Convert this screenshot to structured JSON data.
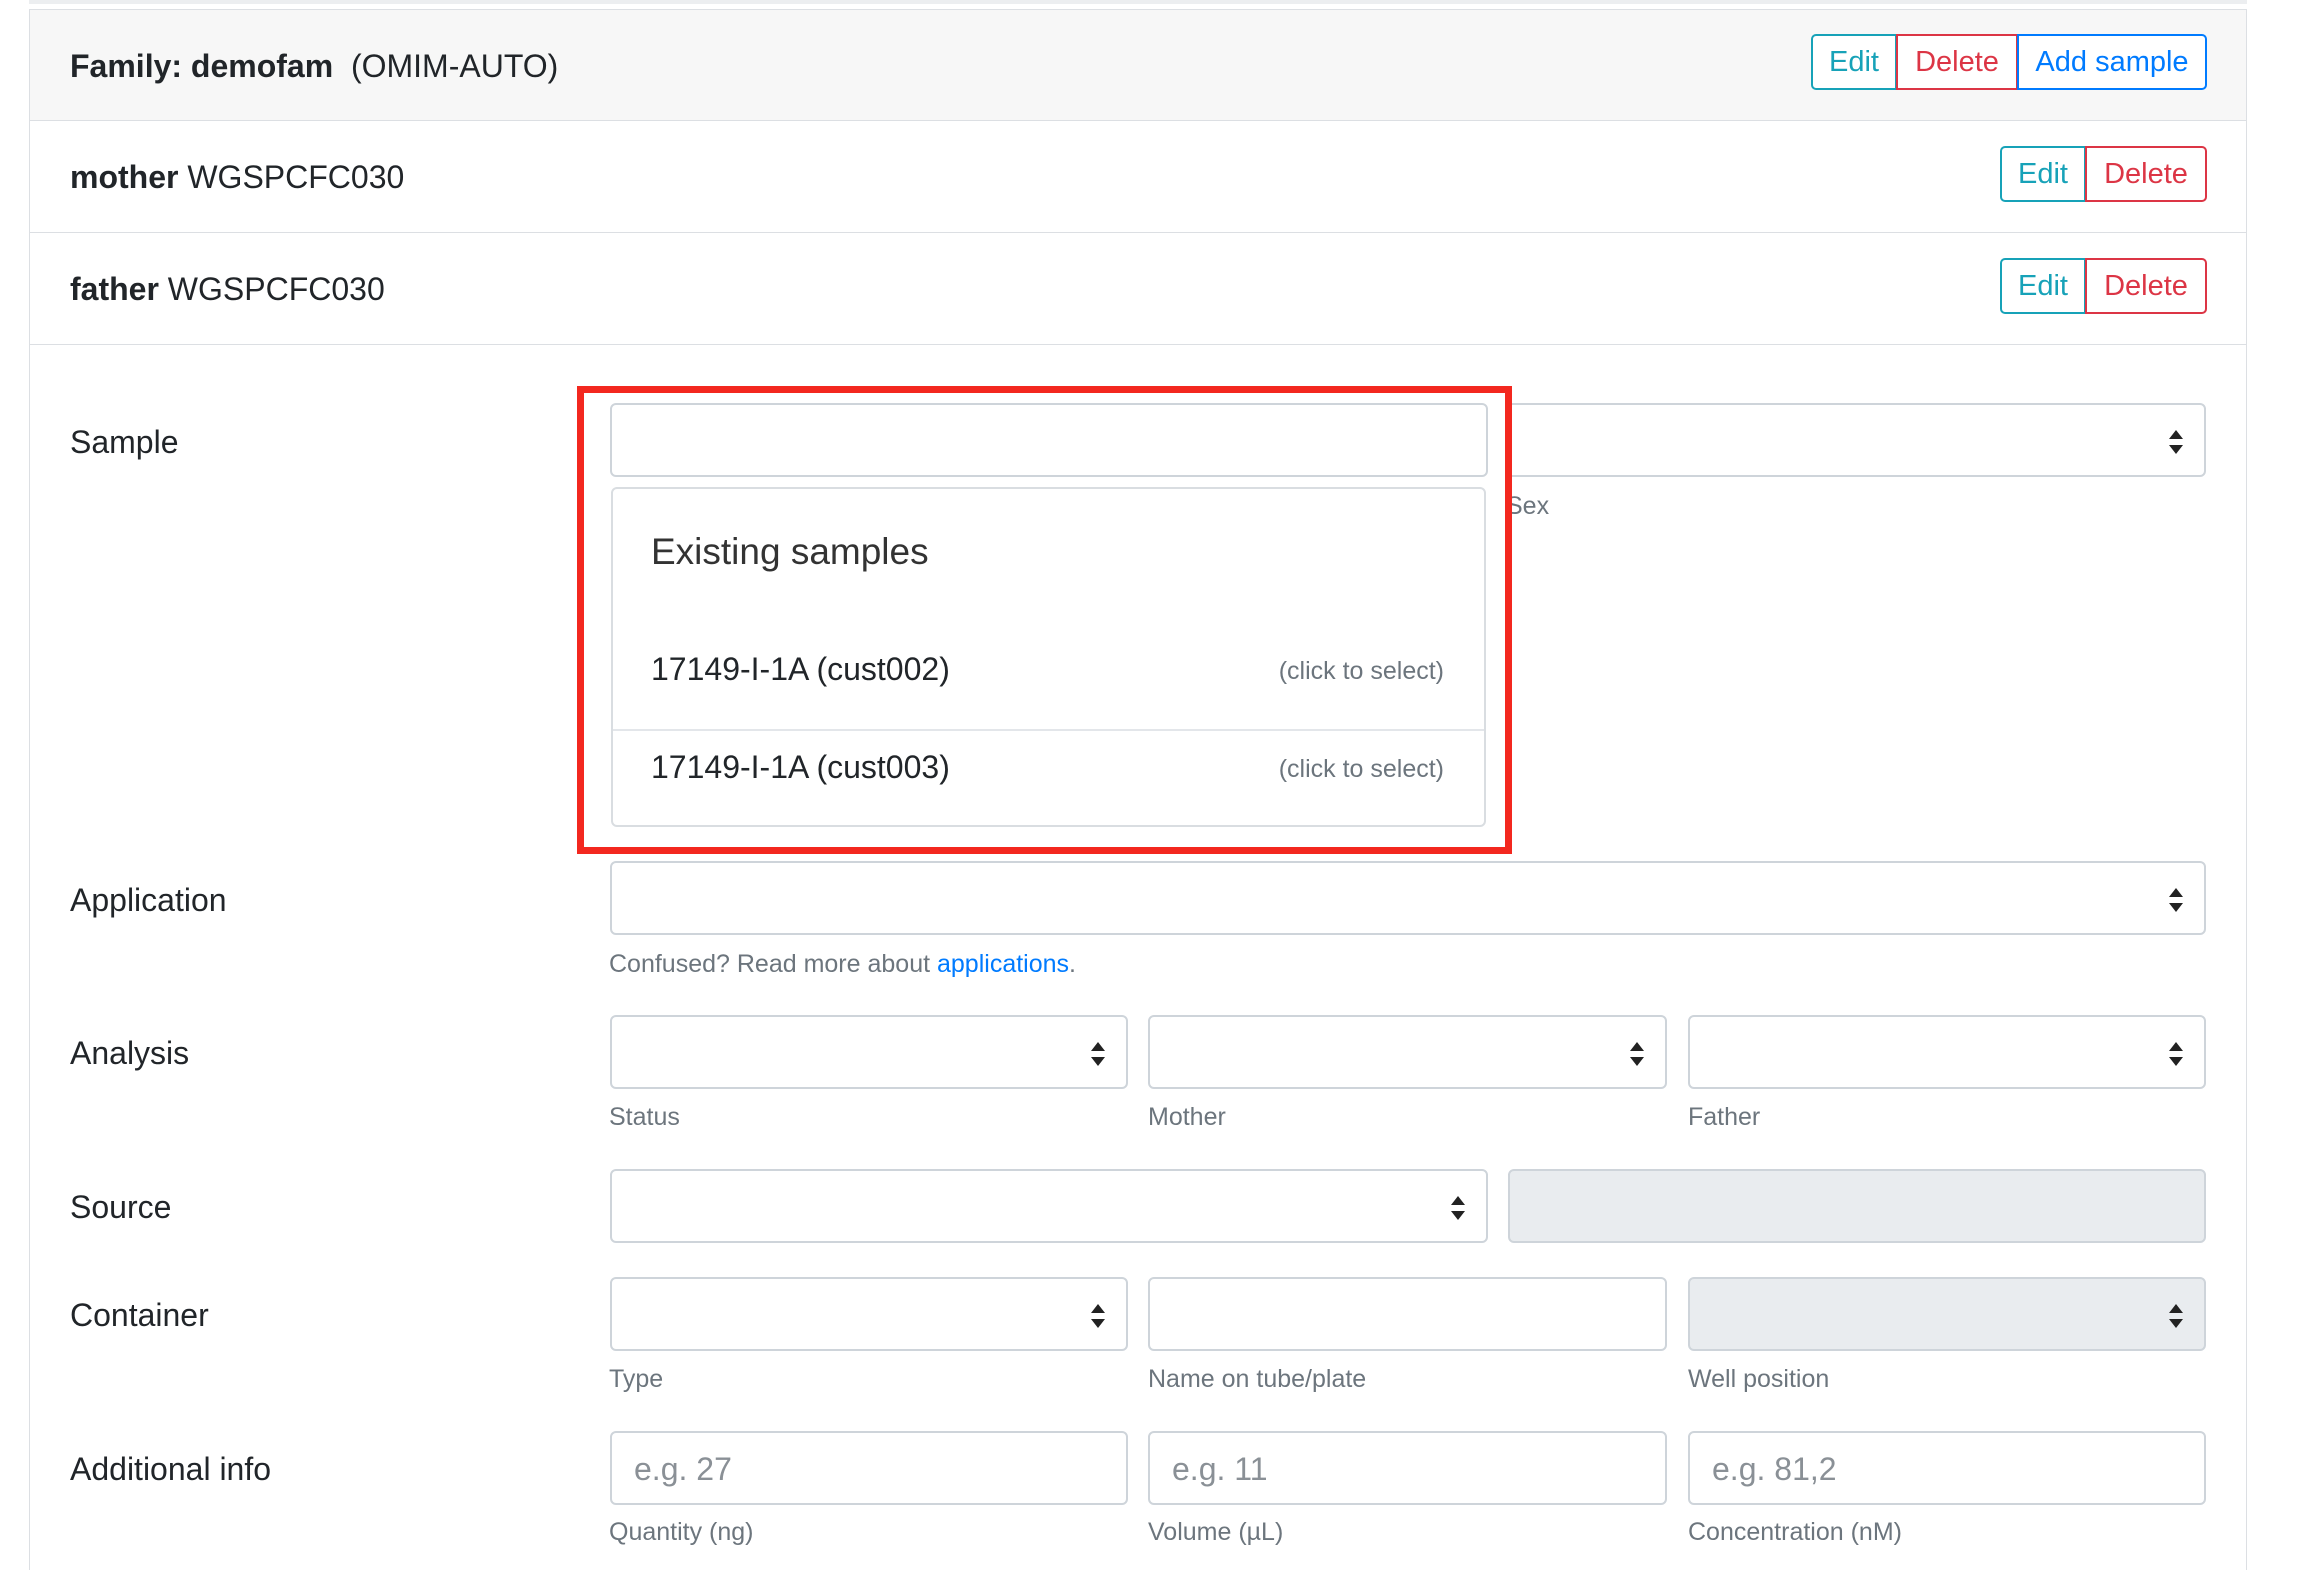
{
  "family": {
    "label": "Family: demofam",
    "panel": "(OMIM-AUTO)",
    "edit": "Edit",
    "delete": "Delete",
    "add_sample": "Add sample"
  },
  "samples": [
    {
      "relation": "mother",
      "name": "WGSPCFC030",
      "edit": "Edit",
      "delete": "Delete"
    },
    {
      "relation": "father",
      "name": "WGSPCFC030",
      "edit": "Edit",
      "delete": "Delete"
    }
  ],
  "form": {
    "sample_label": "Sample",
    "sample_input_value": "",
    "sex_help": "Sex",
    "existing": {
      "heading": "Existing samples",
      "items": [
        {
          "name": "17149-I-1A (cust002)",
          "hint": "(click to select)"
        },
        {
          "name": "17149-I-1A (cust003)",
          "hint": "(click to select)"
        }
      ]
    },
    "application_label": "Application",
    "application_help_prefix": "Confused? Read more about ",
    "application_help_link": "applications",
    "application_help_suffix": ".",
    "analysis_label": "Analysis",
    "status_help": "Status",
    "mother_help": "Mother",
    "father_help": "Father",
    "source_label": "Source",
    "container_label": "Container",
    "type_help": "Type",
    "name_help": "Name on tube/plate",
    "well_help": "Well position",
    "additional_label": "Additional info",
    "quantity_placeholder": "e.g. 27",
    "volume_placeholder": "e.g. 11",
    "concentration_placeholder": "e.g. 81,2",
    "quantity_help": "Quantity (ng)",
    "volume_help": "Volume (µL)",
    "concentration_help": "Concentration (nM)"
  },
  "colors": {
    "info": "#17a2b8",
    "danger": "#dc3545",
    "primary": "#007bff",
    "highlight": "#f3281f"
  }
}
